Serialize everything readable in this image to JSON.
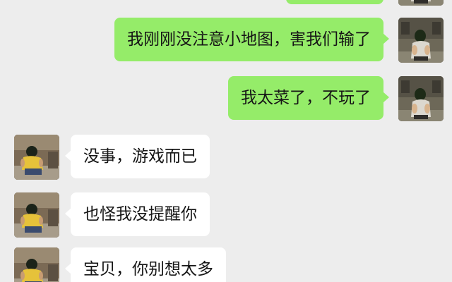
{
  "conversation": {
    "messages": [
      {
        "sender": "me",
        "text": ""
      },
      {
        "sender": "me",
        "text": "我刚刚没注意小地图，害我们输了"
      },
      {
        "sender": "me",
        "text": "我太菜了，不玩了"
      },
      {
        "sender": "other",
        "text": "没事，游戏而已"
      },
      {
        "sender": "other",
        "text": "也怪我没提醒你"
      },
      {
        "sender": "other",
        "text": "宝贝，你别想太多"
      }
    ]
  },
  "colors": {
    "background": "#ededed",
    "outgoing_bubble": "#95ec69",
    "incoming_bubble": "#ffffff",
    "text": "#161616"
  },
  "icons": {
    "my_avatar": "user-avatar-photo",
    "other_avatar": "contact-avatar-photo"
  }
}
